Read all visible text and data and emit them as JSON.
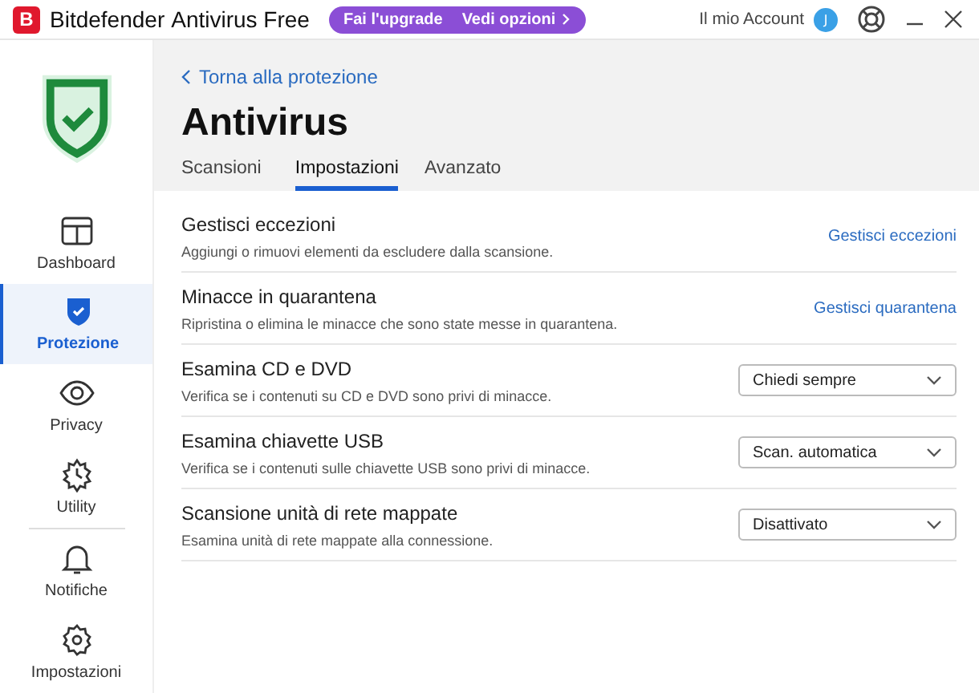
{
  "window": {
    "brand_letter": "B",
    "title": "Bitdefender",
    "subtitle": "Antivirus Free",
    "upgrade": {
      "label": "Fai l'upgrade",
      "link": "Vedi opzioni"
    },
    "account": "Il mio Account",
    "avatar": "J"
  },
  "sidebar": {
    "items": [
      {
        "label": "Dashboard",
        "kind": "dashboard",
        "selected": false
      },
      {
        "label": "Protezione",
        "kind": "shield",
        "selected": true
      },
      {
        "label": "Privacy",
        "kind": "eye",
        "selected": false
      },
      {
        "label": "Utility",
        "kind": "utility",
        "selected": false
      },
      {
        "label": "Notifiche",
        "kind": "bell",
        "selected": false,
        "divider": true
      },
      {
        "label": "Impostazioni",
        "kind": "gear",
        "selected": false
      }
    ]
  },
  "back_link": "Torna alla protezione",
  "page_title": "Antivirus",
  "tabs": [
    {
      "label": "Scansioni",
      "selected": false
    },
    {
      "label": "Impostazioni",
      "selected": true
    },
    {
      "label": "Avanzato",
      "selected": false
    }
  ],
  "settings": [
    {
      "title": "Gestisci eccezioni",
      "description": "Aggiungi o rimuovi elementi da escludere dalla scansione.",
      "kind": "link",
      "action": "Gestisci eccezioni"
    },
    {
      "title": "Minacce in quarantena",
      "description": "Ripristina o elimina le minacce che sono state messe in quarantena.",
      "kind": "link",
      "action": "Gestisci quarantena"
    },
    {
      "title": "Esamina CD e DVD",
      "description": "Verifica se i contenuti su CD e DVD sono privi di minacce.",
      "kind": "select",
      "action": "Chiedi sempre"
    },
    {
      "title": "Esamina chiavette USB",
      "description": "Verifica se i contenuti sulle chiavette USB sono privi di minacce.",
      "kind": "select",
      "action": "Scan. automatica"
    },
    {
      "title": "Scansione unità di rete mappate",
      "description": "Esamina unità di rete mappate alla connessione.",
      "kind": "select",
      "action": "Disattivato"
    }
  ]
}
